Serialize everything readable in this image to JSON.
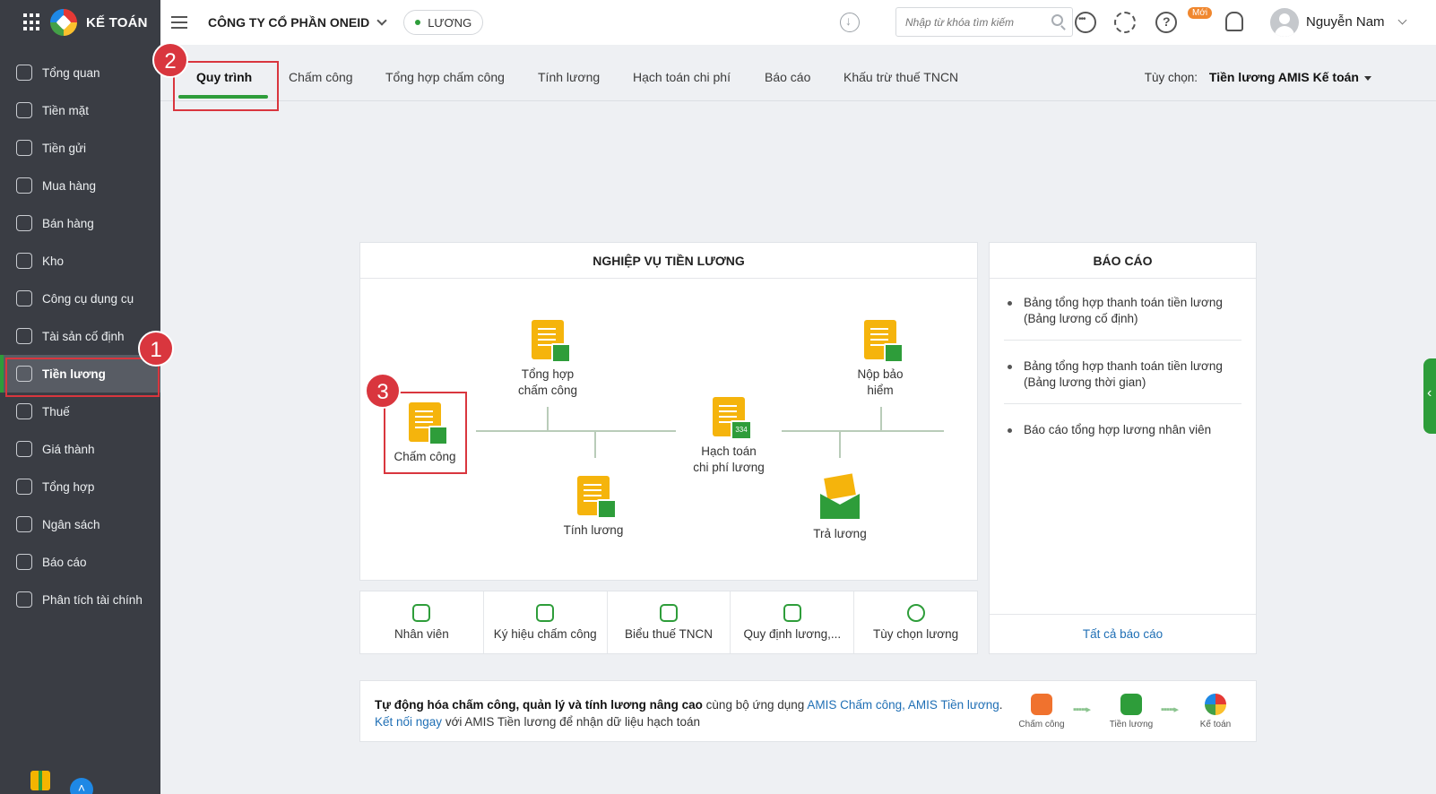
{
  "brand": {
    "name": "KẾ TOÁN"
  },
  "sidebar": {
    "items": [
      {
        "label": "Tổng quan",
        "icon": "dashboard-icon"
      },
      {
        "label": "Tiền mặt",
        "icon": "money-bag-icon"
      },
      {
        "label": "Tiền gửi",
        "icon": "bank-icon"
      },
      {
        "label": "Mua hàng",
        "icon": "shopping-bag-icon"
      },
      {
        "label": "Bán hàng",
        "icon": "cart-icon"
      },
      {
        "label": "Kho",
        "icon": "warehouse-icon"
      },
      {
        "label": "Công cụ dụng cụ",
        "icon": "tools-icon"
      },
      {
        "label": "Tài sản cố định",
        "icon": "car-icon"
      },
      {
        "label": "Tiền lương",
        "icon": "payroll-icon",
        "active": true
      },
      {
        "label": "Thuế",
        "icon": "tax-icon"
      },
      {
        "label": "Giá thành",
        "icon": "price-tag-icon"
      },
      {
        "label": "Tổng hợp",
        "icon": "summary-icon"
      },
      {
        "label": "Ngân sách",
        "icon": "budget-icon"
      },
      {
        "label": "Báo cáo",
        "icon": "report-chart-icon"
      },
      {
        "label": "Phân tích tài chính",
        "icon": "analytics-icon"
      }
    ]
  },
  "header": {
    "company": "CÔNG TY CỔ PHẦN ONEID",
    "module": "LƯƠNG",
    "search_placeholder": "Nhập từ khóa tìm kiếm",
    "new_badge": "Mới",
    "username": "Nguyễn Nam"
  },
  "tabs": [
    {
      "label": "Quy trình",
      "active": true
    },
    {
      "label": "Chấm công"
    },
    {
      "label": "Tổng hợp chấm công"
    },
    {
      "label": "Tính lương"
    },
    {
      "label": "Hạch toán chi phí"
    },
    {
      "label": "Báo cáo"
    },
    {
      "label": "Khấu trừ thuế TNCN"
    }
  ],
  "options": {
    "label": "Tùy chọn:",
    "value": "Tiền lương AMIS Kế toán"
  },
  "callouts": [
    "1",
    "2",
    "3"
  ],
  "process": {
    "title": "NGHIỆP VỤ TIỀN LƯƠNG",
    "nodes": {
      "attendance": "Chấm công",
      "attendance_summary_1": "Tổng hợp",
      "attendance_summary_2": "chấm công",
      "salary_calc": "Tính lương",
      "cost_accounting_1": "Hạch toán",
      "cost_accounting_2": "chi phí lương",
      "insurance_1": "Nộp bảo",
      "insurance_2": "hiểm",
      "pay_salary": "Trả lương",
      "account_code": "334"
    }
  },
  "reports": {
    "title": "BÁO CÁO",
    "items": [
      {
        "line1": "Bảng tổng hợp thanh toán tiền lương",
        "line2": "(Bảng lương cố định)"
      },
      {
        "line1": "Bảng tổng hợp thanh toán tiền lương",
        "line2": "(Bảng lương thời gian)"
      },
      {
        "line1": "Báo cáo tổng hợp lương nhân viên",
        "line2": ""
      }
    ],
    "all_link": "Tất cả báo cáo"
  },
  "tools": [
    {
      "label": "Nhân viên",
      "icon": "employee-icon"
    },
    {
      "label": "Ký hiệu chấm công",
      "icon": "fingerprint-icon"
    },
    {
      "label": "Biểu thuế TNCN",
      "icon": "tax-table-icon"
    },
    {
      "label": "Quy định lương,...",
      "icon": "salary-rule-icon"
    },
    {
      "label": "Tùy chọn lương",
      "icon": "settings-icon"
    }
  ],
  "promo": {
    "bold": "Tự động hóa chấm công, quản lý và tính lương nâng cao",
    "text1": " cùng bộ ứng dụng ",
    "apps_link": "AMIS Chấm công, AMIS Tiền lương",
    "dot": ".",
    "connect_link": "Kết nối ngay",
    "text2": " với AMIS Tiền lương để nhận dữ liệu hạch toán",
    "apps": [
      "Chấm công",
      "Tiền lương",
      "Kế toán"
    ]
  },
  "colors": {
    "accent": "#2e9d3a",
    "callout": "#d9363e",
    "sidebar": "#3a3d44",
    "link": "#1f6fb5",
    "doc": "#f5b40c"
  }
}
